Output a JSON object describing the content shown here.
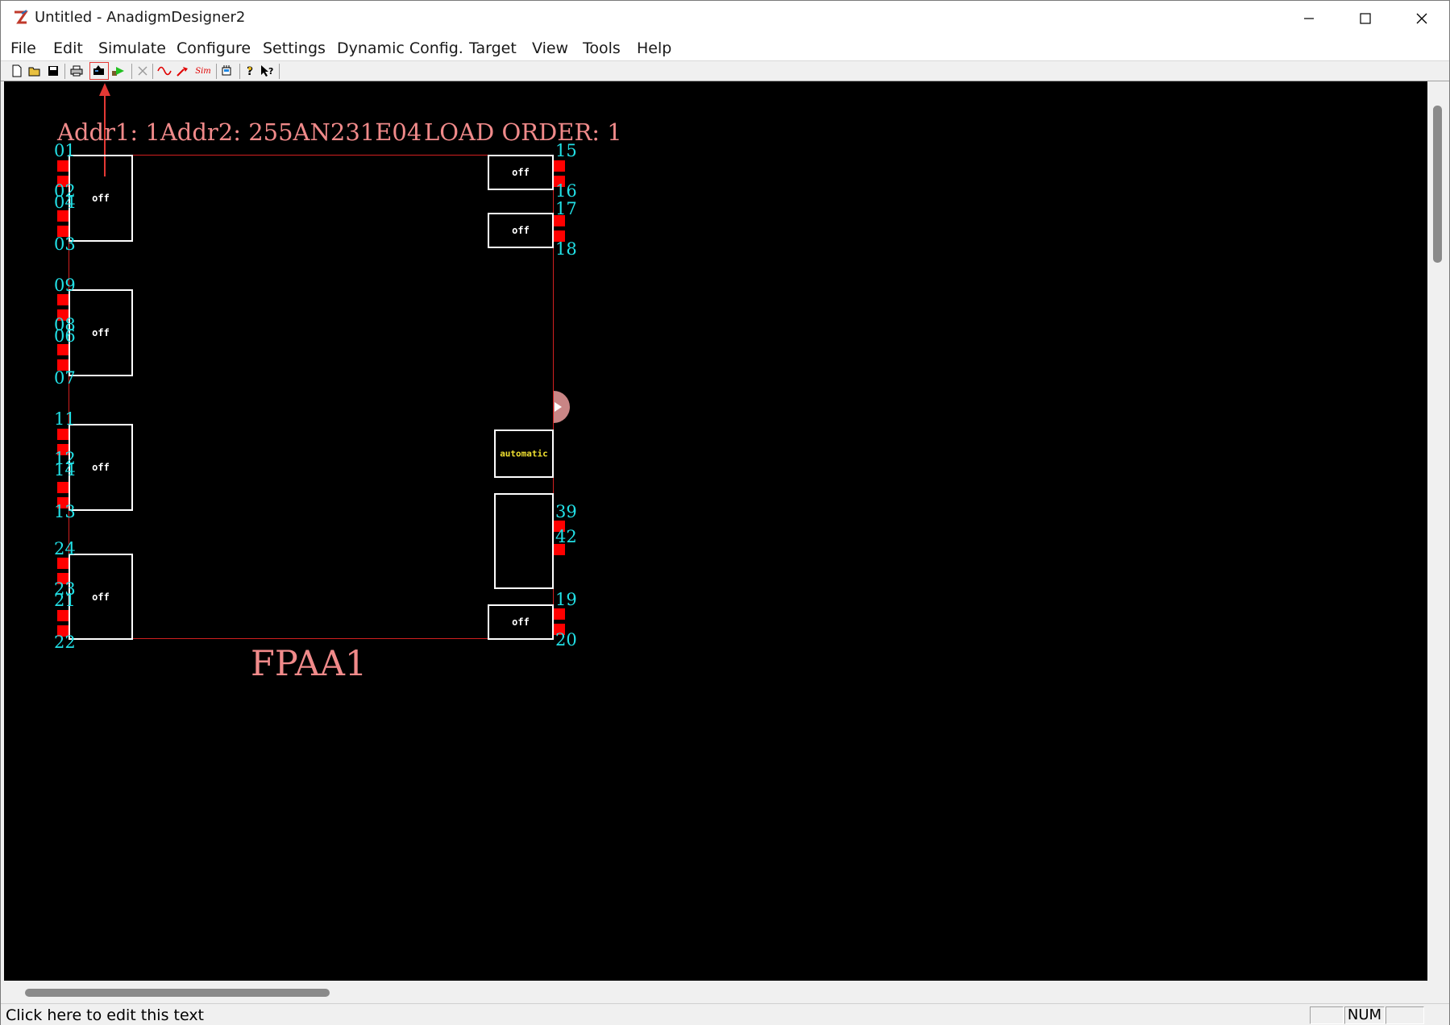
{
  "window": {
    "title": "Untitled - AnadigmDesigner2"
  },
  "menu": [
    "File",
    "Edit",
    "Simulate",
    "Configure",
    "Settings",
    "Dynamic Config.",
    "Target",
    "View",
    "Tools",
    "Help"
  ],
  "toolbar": {
    "buttons": [
      "new-file",
      "open-file",
      "save-file",
      "print",
      "download-to-chip",
      "run",
      "delete",
      "signal-generator",
      "oscilloscope-probe",
      "sim",
      "setup",
      "help",
      "context-help"
    ],
    "sim_label": "Sim",
    "highlighted": "download-to-chip"
  },
  "fpaa": {
    "header": "Addr1: 1Addr2: 255AN231E04",
    "load_order": "LOAD ORDER: 1",
    "name": "FPAA1",
    "left_pins": [
      "01",
      "02",
      "04",
      "03",
      "09",
      "08",
      "06",
      "07",
      "11",
      "12",
      "14",
      "13",
      "24",
      "23",
      "21",
      "22"
    ],
    "right_pins": [
      "15",
      "16",
      "17",
      "18",
      "39",
      "42",
      "19",
      "20"
    ],
    "cells": {
      "io1": "off",
      "io2": "off",
      "io3": "off",
      "io4": "off",
      "io5": "off",
      "io6": "off",
      "io7": "off",
      "clock": "automatic"
    }
  },
  "status": {
    "text": "Click here to edit this text",
    "num": "NUM"
  }
}
